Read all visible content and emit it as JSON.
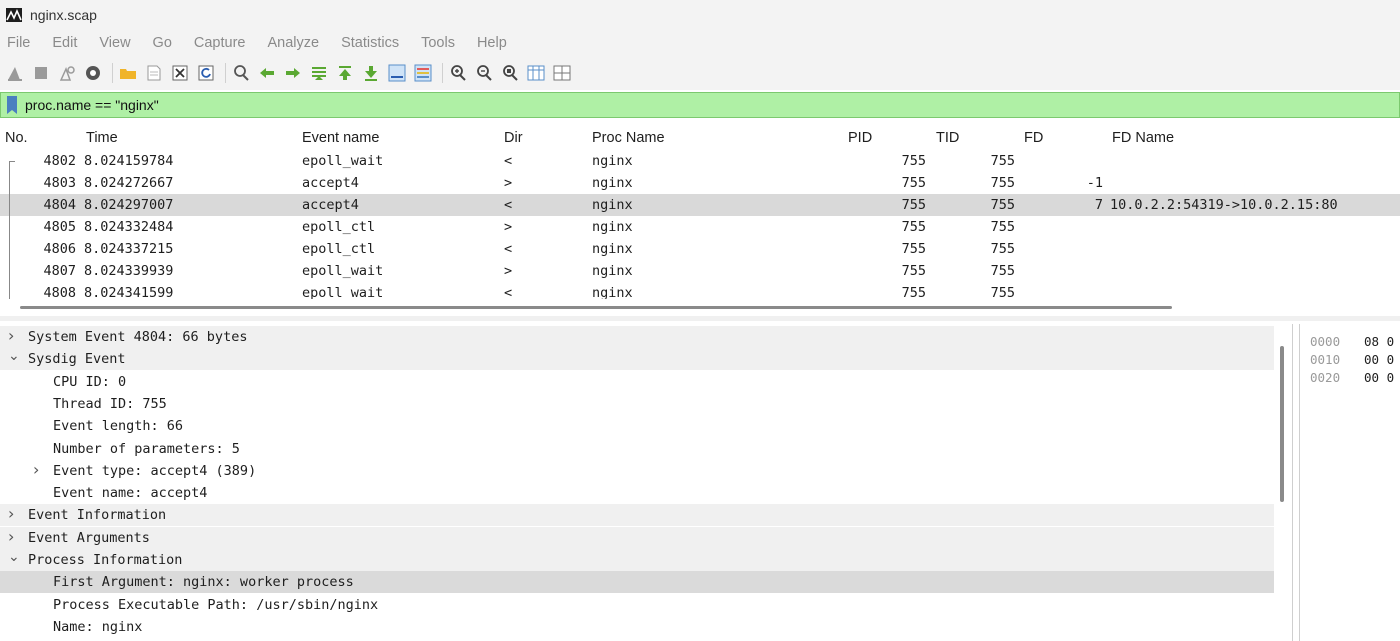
{
  "window": {
    "title": "nginx.scap"
  },
  "menu": [
    "File",
    "Edit",
    "View",
    "Go",
    "Capture",
    "Analyze",
    "Statistics",
    "Tools",
    "Help"
  ],
  "toolbar": {
    "icons": [
      "shark-fin-start-icon",
      "stop-icon",
      "restart-icon",
      "options-gear-icon",
      "open-folder-icon",
      "save-file-icon",
      "close-file-icon",
      "reload-icon",
      "find-icon",
      "go-back-icon",
      "go-forward-icon",
      "go-to-packet-icon",
      "first-packet-icon",
      "last-packet-icon",
      "autoscroll-icon",
      "colorize-icon",
      "zoom-in-icon",
      "zoom-out-icon",
      "zoom-normal-icon",
      "resize-columns-icon",
      "layout-icon"
    ]
  },
  "filter": {
    "value": "proc.name == \"nginx\""
  },
  "packet_list": {
    "columns": [
      "No.",
      "Time",
      "Event name",
      "Dir",
      "Proc Name",
      "PID",
      "TID",
      "FD",
      "FD Name"
    ],
    "rows": [
      {
        "no": "4802",
        "time": "8.024159784",
        "event": "epoll_wait",
        "dir": "<",
        "proc": "nginx",
        "pid": "755",
        "tid": "755",
        "fd": "",
        "fdname": ""
      },
      {
        "no": "4803",
        "time": "8.024272667",
        "event": "accept4",
        "dir": ">",
        "proc": "nginx",
        "pid": "755",
        "tid": "755",
        "fd": "-1",
        "fdname": ""
      },
      {
        "no": "4804",
        "time": "8.024297007",
        "event": "accept4",
        "dir": "<",
        "proc": "nginx",
        "pid": "755",
        "tid": "755",
        "fd": "7",
        "fdname": "10.0.2.2:54319->10.0.2.15:80"
      },
      {
        "no": "4805",
        "time": "8.024332484",
        "event": "epoll_ctl",
        "dir": ">",
        "proc": "nginx",
        "pid": "755",
        "tid": "755",
        "fd": "",
        "fdname": ""
      },
      {
        "no": "4806",
        "time": "8.024337215",
        "event": "epoll_ctl",
        "dir": "<",
        "proc": "nginx",
        "pid": "755",
        "tid": "755",
        "fd": "",
        "fdname": ""
      },
      {
        "no": "4807",
        "time": "8.024339939",
        "event": "epoll_wait",
        "dir": ">",
        "proc": "nginx",
        "pid": "755",
        "tid": "755",
        "fd": "",
        "fdname": ""
      },
      {
        "no": "4808",
        "time": "8.024341599",
        "event": "epoll_wait",
        "dir": "<",
        "proc": "nginx",
        "pid": "755",
        "tid": "755",
        "fd": "",
        "fdname": ""
      }
    ]
  },
  "details": {
    "rows": [
      {
        "text": "System Event 4804: 66 bytes",
        "chevron": ">"
      },
      {
        "text": "Sysdig Event",
        "chevron": "v"
      },
      {
        "text": "CPU ID: 0",
        "chevron": ""
      },
      {
        "text": "Thread ID: 755",
        "chevron": ""
      },
      {
        "text": "Event length: 66",
        "chevron": ""
      },
      {
        "text": "Number of parameters: 5",
        "chevron": ""
      },
      {
        "text": "Event type: accept4 (389)",
        "chevron": ">"
      },
      {
        "text": "Event name: accept4",
        "chevron": ""
      },
      {
        "text": "Event Information",
        "chevron": ">"
      },
      {
        "text": "Event Arguments",
        "chevron": ">"
      },
      {
        "text": "Process Information",
        "chevron": "v"
      },
      {
        "text": "First Argument: nginx: worker process",
        "chevron": ""
      },
      {
        "text": "Process Executable Path: /usr/sbin/nginx",
        "chevron": ""
      },
      {
        "text": "Name: nginx",
        "chevron": ""
      }
    ]
  },
  "bytes": {
    "rows": [
      {
        "offset": "0000",
        "hex": "08 0"
      },
      {
        "offset": "0010",
        "hex": "00 0"
      },
      {
        "offset": "0020",
        "hex": "00 0"
      }
    ]
  },
  "colors": {
    "filter_bg": "#aff0a5",
    "selected_row": "#d9d9d9",
    "band_row": "#f0f0f0"
  }
}
